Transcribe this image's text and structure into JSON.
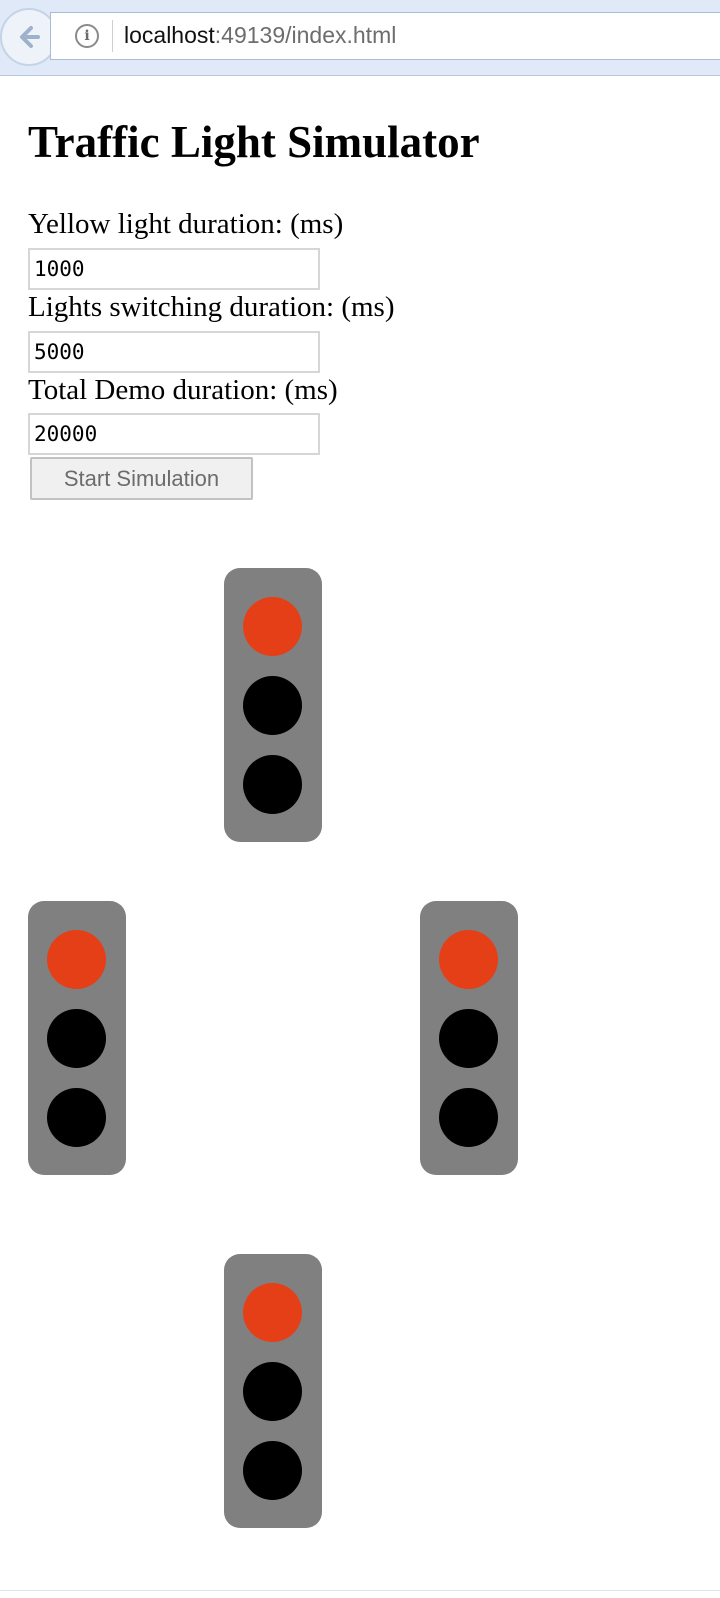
{
  "browser": {
    "url_host": "localhost",
    "url_rest": ":49139/index.html",
    "info_glyph": "i"
  },
  "page": {
    "title": "Traffic Light Simulator",
    "fields": [
      {
        "label": "Yellow light duration: (ms)",
        "value": "1000"
      },
      {
        "label": "Lights switching duration: (ms)",
        "value": "5000"
      },
      {
        "label": "Total Demo duration: (ms)",
        "value": "20000"
      }
    ],
    "start_button": "Start Simulation"
  },
  "lights": {
    "north": {
      "top": "red",
      "mid": "off",
      "bot": "off"
    },
    "west": {
      "top": "red",
      "mid": "off",
      "bot": "off"
    },
    "east": {
      "top": "red",
      "mid": "off",
      "bot": "off"
    },
    "south": {
      "top": "red",
      "mid": "off",
      "bot": "off"
    }
  },
  "colors": {
    "red": "#e53f17",
    "yellow": "#f2c200",
    "green": "#22b14c",
    "off": "#000000",
    "housing": "#808080"
  }
}
